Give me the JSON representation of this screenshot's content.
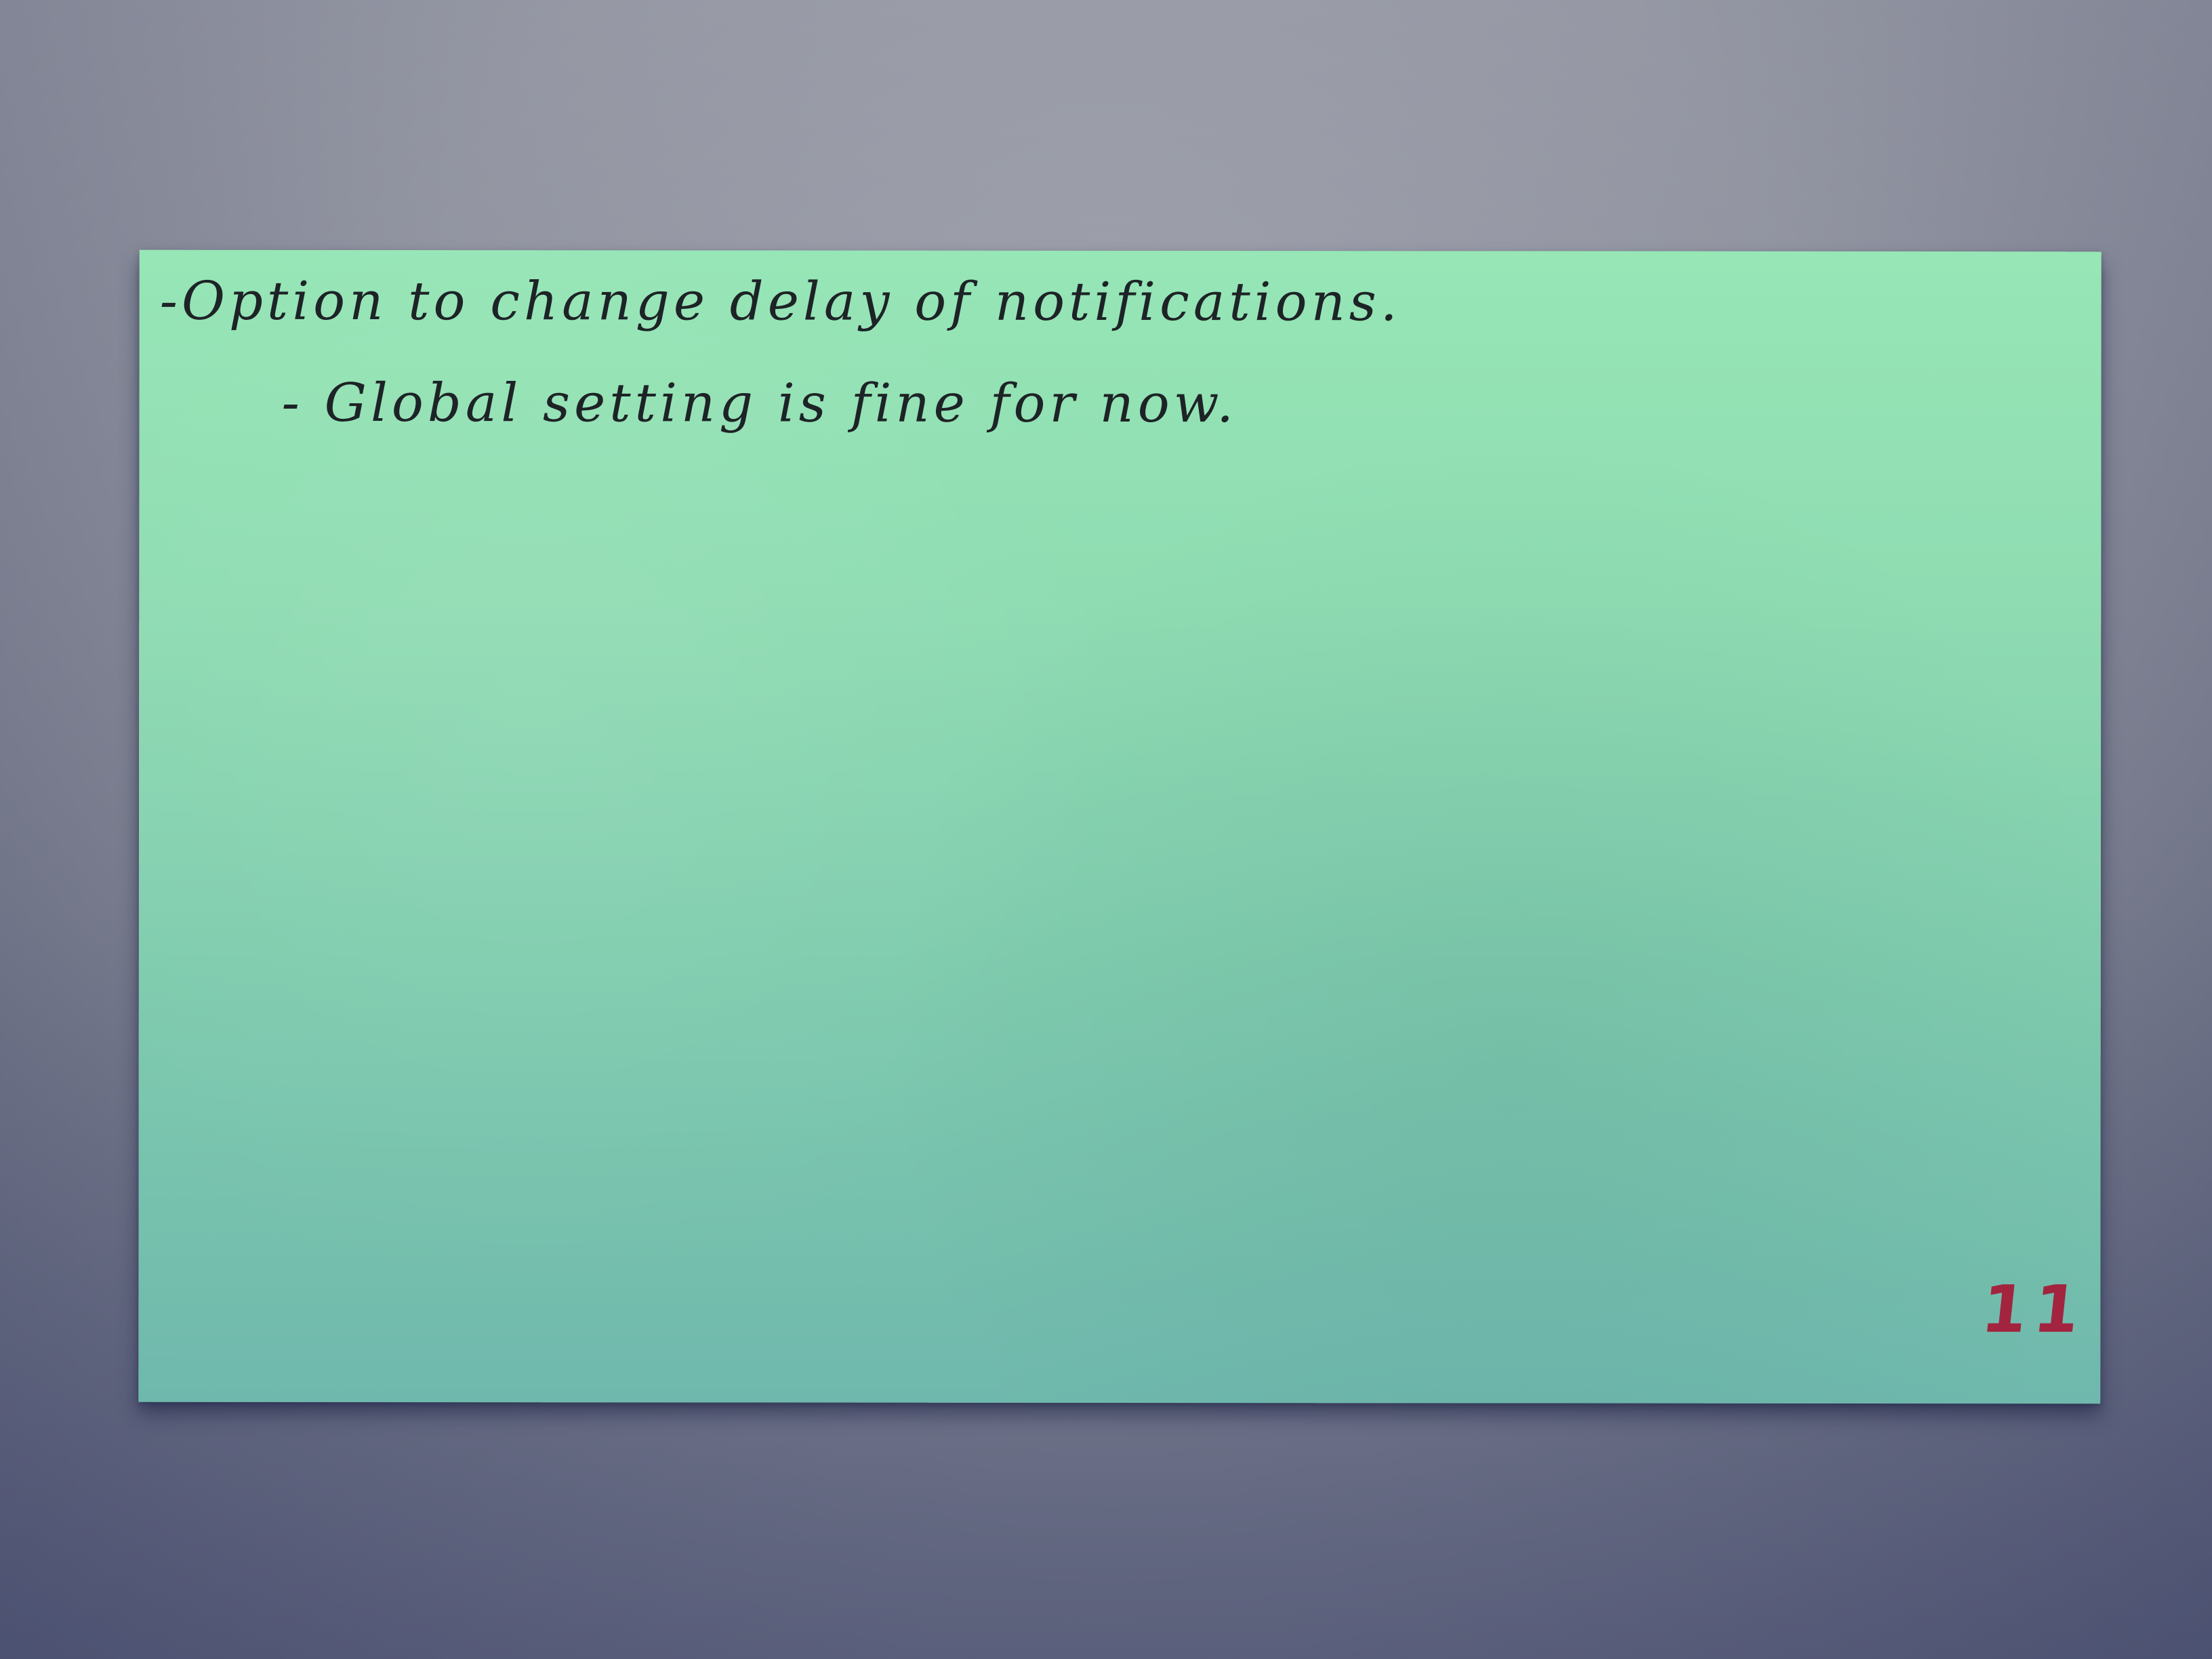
{
  "scene": {
    "background_color": "#8f93a2",
    "card_color": "#8fdcb2"
  },
  "card": {
    "lines": [
      "-Option to change delay of notifications.",
      "- Global setting is fine for now."
    ],
    "tally": "11",
    "ink_color": "#1d2326",
    "tally_color": "#a3243f"
  }
}
